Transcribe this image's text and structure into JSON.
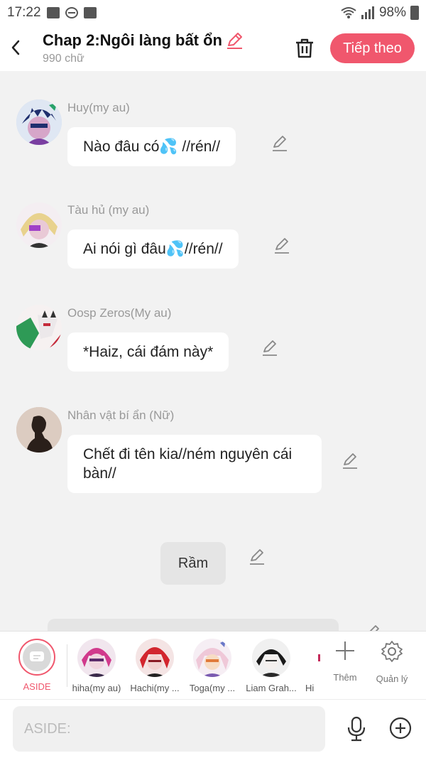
{
  "status_bar": {
    "time": "17:22",
    "battery": "98%"
  },
  "header": {
    "back_icon": "chevron-left-icon",
    "title": "Chap 2:Ngôi làng bất ổn",
    "word_count": "990 chữ",
    "next_label": "Tiếp theo",
    "accent_color": "#f0576d"
  },
  "messages": [
    {
      "character": "Huy(my au)",
      "text": "Nào đâu có💦 //rén//"
    },
    {
      "character": "Tàu hủ (my au)",
      "text": "Ai nói gì đâu💦//rén//"
    },
    {
      "character": "Oosp Zeros(My au)",
      "text": "*Haiz, cái đám này*"
    },
    {
      "character": "Nhân vật bí ẩn (Nữ)",
      "text": "Chết đi tên kia//ném nguyên cái bàn//"
    }
  ],
  "narration": {
    "text": "Rầm"
  },
  "character_bar": {
    "aside_label": "ASIDE",
    "characters": [
      {
        "label": "hiha(my au)"
      },
      {
        "label": "Hachi(my ..."
      },
      {
        "label": "Toga(my ..."
      },
      {
        "label": "Liam Grah..."
      },
      {
        "label": "Hi"
      }
    ],
    "more_label": "Thêm",
    "manage_label": "Quản lý"
  },
  "input": {
    "placeholder": "ASIDE:"
  }
}
